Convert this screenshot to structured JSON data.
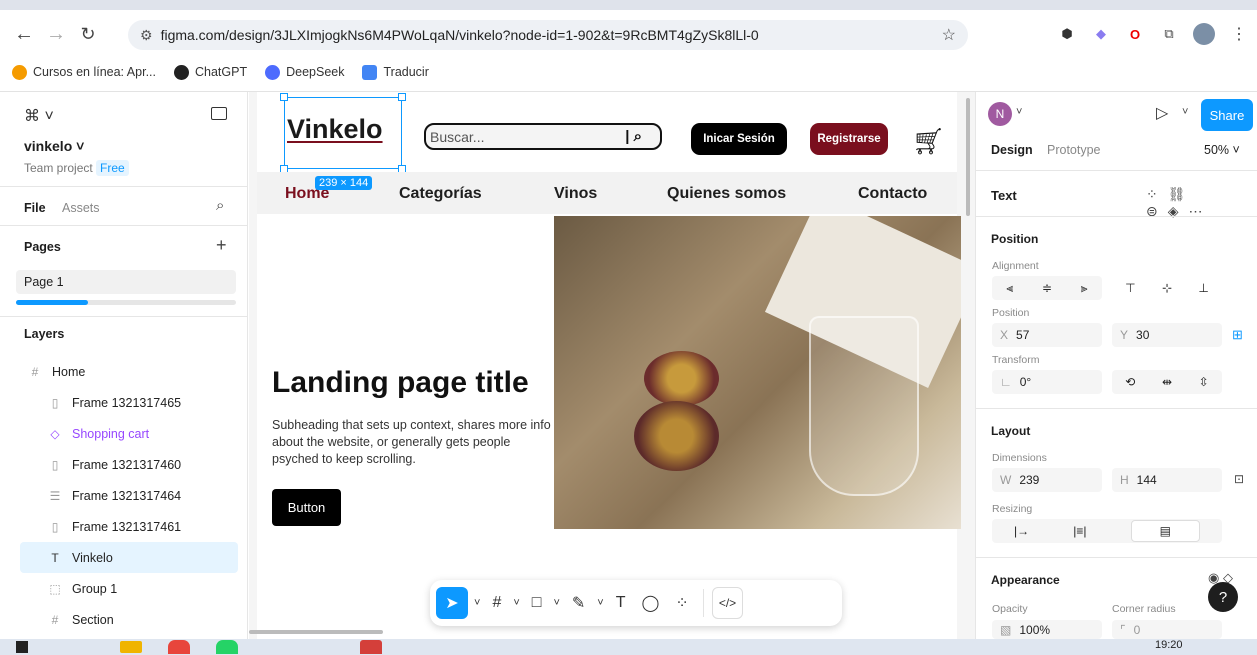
{
  "browser": {
    "url": "figma.com/design/3JLXImjogkNs6M4PWoLqaN/vinkelo?node-id=1-902&t=9RcBMT4gZySk8lLl-0",
    "bookmarks": [
      "Cursos en línea: Apr...",
      "ChatGPT",
      "DeepSeek",
      "Traducir"
    ]
  },
  "left": {
    "project_name": "vinkelo",
    "team": "Team project",
    "plan": "Free",
    "tab_file": "File",
    "tab_assets": "Assets",
    "pages_title": "Pages",
    "page1": "Page 1",
    "layers_title": "Layers",
    "layers": [
      {
        "name": "Home",
        "icon": "#",
        "indent": false
      },
      {
        "name": "Frame 1321317465",
        "icon": "▯",
        "indent": true
      },
      {
        "name": "Shopping cart",
        "icon": "◇",
        "indent": true,
        "component": true
      },
      {
        "name": "Frame 1321317460",
        "icon": "▯",
        "indent": true
      },
      {
        "name": "Frame 1321317464",
        "icon": "☰",
        "indent": true
      },
      {
        "name": "Frame 1321317461",
        "icon": "▯",
        "indent": true
      },
      {
        "name": "Vinkelo",
        "icon": "T",
        "indent": true,
        "selected": true
      },
      {
        "name": "Group 1",
        "icon": "⬚",
        "indent": true
      },
      {
        "name": "Section",
        "icon": "#",
        "indent": true
      }
    ]
  },
  "design": {
    "logo": "Vinkelo",
    "search_placeholder": "Buscar...",
    "login": "Inicar Sesión",
    "register": "Registrarse",
    "size_badge": "239 × 144",
    "nav": [
      "Home",
      "Categorías",
      "Vinos",
      "Quienes somos",
      "Contacto"
    ],
    "hero_title": "Landing page title",
    "hero_sub": "Subheading that sets up context, shares more info about the website, or generally gets people psyched to keep scrolling.",
    "hero_button": "Button",
    "colors": {
      "brand": "#7a0f1e",
      "dark": "#000000",
      "accent": "#0d99ff"
    }
  },
  "right": {
    "avatar": "N",
    "share": "Share",
    "tab_design": "Design",
    "tab_prototype": "Prototype",
    "zoom": "50%",
    "section_text": "Text",
    "position_title": "Position",
    "alignment_label": "Alignment",
    "position_label": "Position",
    "x_key": "X",
    "x_val": "57",
    "y_key": "Y",
    "y_val": "30",
    "transform_label": "Transform",
    "rotation": "0°",
    "layout_title": "Layout",
    "dimensions_label": "Dimensions",
    "w_key": "W",
    "w_val": "239",
    "h_key": "H",
    "h_val": "144",
    "resizing_label": "Resizing",
    "appearance_title": "Appearance",
    "opacity_label": "Opacity",
    "opacity_val": "100%",
    "radius_label": "Corner radius",
    "radius_val": "0"
  },
  "taskbar": {
    "time": "19:20"
  }
}
